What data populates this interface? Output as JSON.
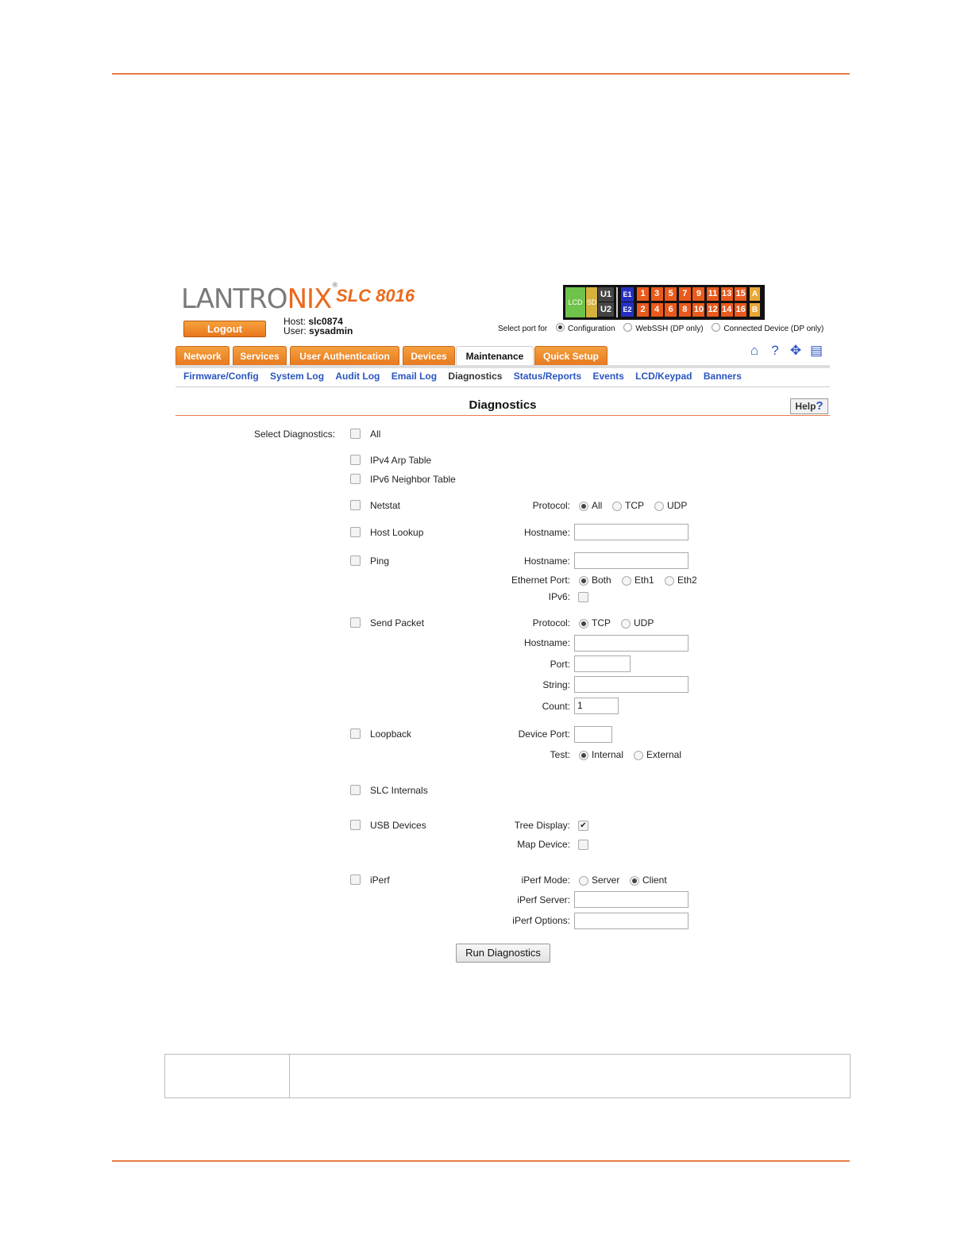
{
  "brand": {
    "logo_main": "LANTRO",
    "logo_x": "NIX",
    "logo_mark": "®",
    "product": "SLC 8016"
  },
  "session": {
    "logout_label": "Logout",
    "host_label": "Host:",
    "host_value": "slc0874",
    "user_label": "User:",
    "user_value": "sysadmin"
  },
  "port_panel": {
    "lcd": "LCD",
    "sd": "SD",
    "u1": "U1",
    "u2": "U2",
    "e1": "E1",
    "e2": "E2",
    "top_ports": [
      "1",
      "3",
      "5",
      "7",
      "9",
      "11",
      "13",
      "15"
    ],
    "bottom_ports": [
      "2",
      "4",
      "6",
      "8",
      "10",
      "12",
      "14",
      "16"
    ],
    "a": "A",
    "b": "B"
  },
  "select_port": {
    "label": "Select port for",
    "options": [
      "Configuration",
      "WebSSH (DP only)",
      "Connected Device (DP only)"
    ],
    "selected": "Configuration"
  },
  "tabs": [
    "Network",
    "Services",
    "User Authentication",
    "Devices",
    "Maintenance",
    "Quick Setup"
  ],
  "active_tab": "Maintenance",
  "toolbar_icons": [
    "home-icon",
    "help-icon",
    "sitemap-icon",
    "log-icon"
  ],
  "subnav": [
    "Firmware/Config",
    "System Log",
    "Audit Log",
    "Email Log",
    "Diagnostics",
    "Status/Reports",
    "Events",
    "LCD/Keypad",
    "Banners"
  ],
  "active_subnav": "Diagnostics",
  "page": {
    "title": "Diagnostics",
    "help_label": "Help"
  },
  "form": {
    "select_label": "Select Diagnostics:",
    "all": "All",
    "ipv4_arp": "IPv4 Arp Table",
    "ipv6_neighbor": "IPv6 Neighbor Table",
    "netstat": {
      "label": "Netstat",
      "protocol_label": "Protocol:",
      "options": [
        "All",
        "TCP",
        "UDP"
      ],
      "selected": "All"
    },
    "host_lookup": {
      "label": "Host Lookup",
      "hostname_label": "Hostname:",
      "hostname_value": ""
    },
    "ping": {
      "label": "Ping",
      "hostname_label": "Hostname:",
      "hostname_value": "",
      "eth_label": "Ethernet Port:",
      "eth_options": [
        "Both",
        "Eth1",
        "Eth2"
      ],
      "eth_selected": "Both",
      "ipv6_label": "IPv6:"
    },
    "send_packet": {
      "label": "Send Packet",
      "protocol_label": "Protocol:",
      "options": [
        "TCP",
        "UDP"
      ],
      "selected": "TCP",
      "hostname_label": "Hostname:",
      "port_label": "Port:",
      "string_label": "String:",
      "count_label": "Count:",
      "count_value": "1"
    },
    "loopback": {
      "label": "Loopback",
      "device_port_label": "Device Port:",
      "test_label": "Test:",
      "test_options": [
        "Internal",
        "External"
      ],
      "test_selected": "Internal"
    },
    "slc_internals": "SLC Internals",
    "usb_devices": {
      "label": "USB Devices",
      "tree_label": "Tree Display:",
      "tree_checked": true,
      "map_label": "Map Device:",
      "map_checked": false
    },
    "iperf": {
      "label": "iPerf",
      "mode_label": "iPerf Mode:",
      "mode_options": [
        "Server",
        "Client"
      ],
      "mode_selected": "Client",
      "server_label": "iPerf Server:",
      "options_label": "iPerf Options:"
    },
    "run_label": "Run Diagnostics"
  },
  "colors": {
    "accent": "#e87b46",
    "brand_orange": "#ea6a1c",
    "link_blue": "#2a55c0"
  }
}
